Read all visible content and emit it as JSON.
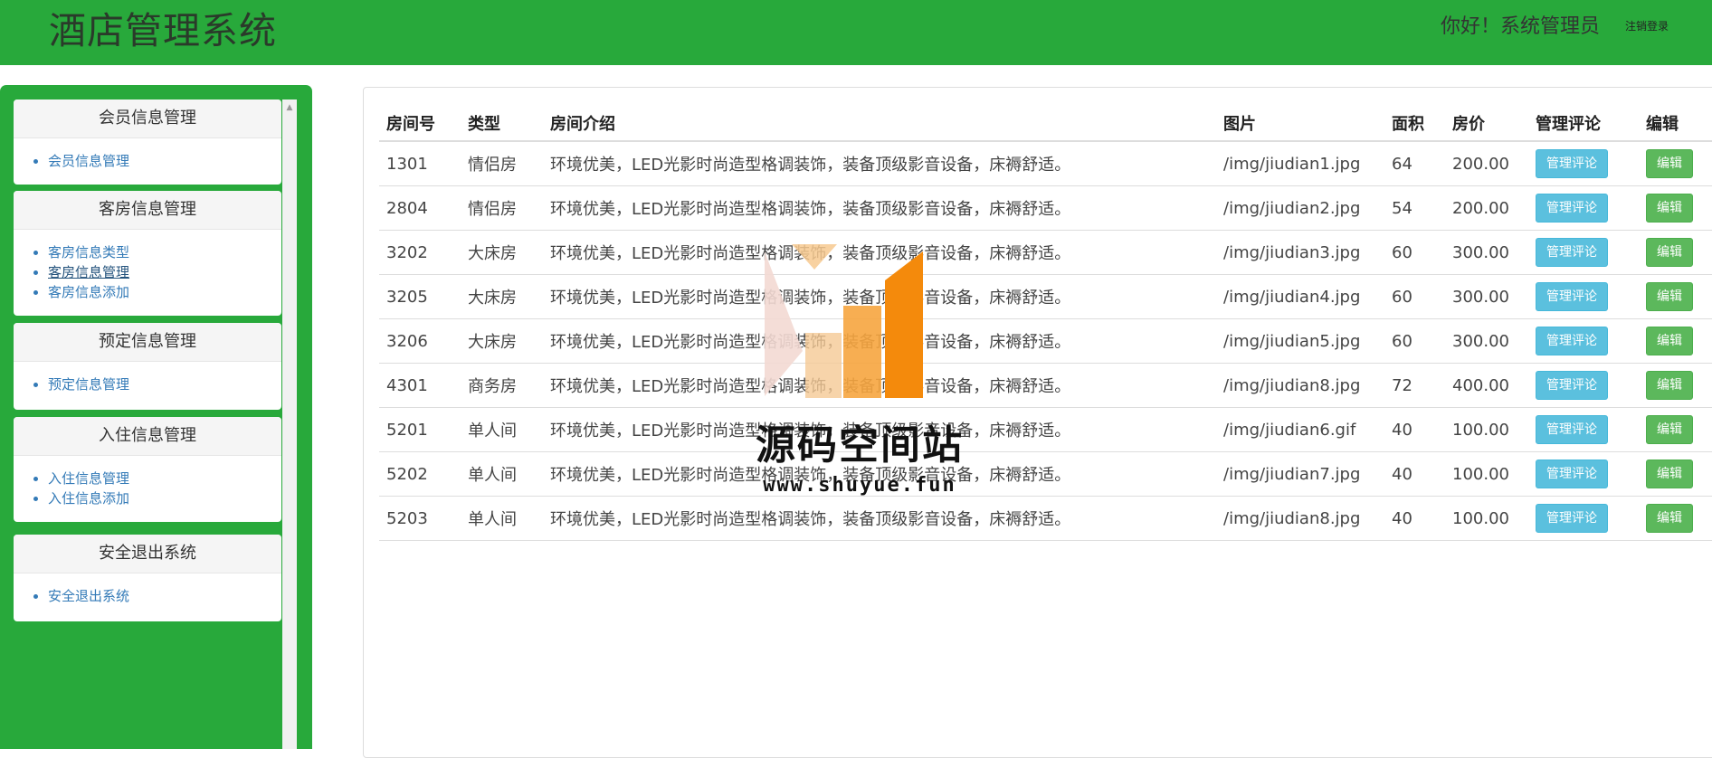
{
  "header": {
    "app_title": "酒店管理系统",
    "greeting": "你好！系统管理员",
    "logout": "注销登录"
  },
  "sidebar": {
    "panels": [
      {
        "title": "会员信息管理",
        "items": [
          "会员信息管理"
        ]
      },
      {
        "title": "客房信息管理",
        "items": [
          "客房信息类型",
          "客房信息管理",
          "客房信息添加"
        ]
      },
      {
        "title": "预定信息管理",
        "items": [
          "预定信息管理"
        ]
      },
      {
        "title": "入住信息管理",
        "items": [
          "入住信息管理",
          "入住信息添加"
        ]
      },
      {
        "title": "安全退出系统",
        "items": [
          "安全退出系统"
        ]
      }
    ]
  },
  "table": {
    "headers": [
      "房间号",
      "类型",
      "房间介绍",
      "图片",
      "面积",
      "房价",
      "管理评论",
      "编辑"
    ],
    "rows": [
      [
        "1301",
        "情侣房",
        "环境优美，LED光影时尚造型格调装饰，装备顶级影音设备，床褥舒适。",
        "/img/jiudian1.jpg",
        "64",
        "200.00"
      ],
      [
        "2804",
        "情侣房",
        "环境优美，LED光影时尚造型格调装饰，装备顶级影音设备，床褥舒适。",
        "/img/jiudian2.jpg",
        "54",
        "200.00"
      ],
      [
        "3202",
        "大床房",
        "环境优美，LED光影时尚造型格调装饰，装备顶级影音设备，床褥舒适。",
        "/img/jiudian3.jpg",
        "60",
        "300.00"
      ],
      [
        "3205",
        "大床房",
        "环境优美，LED光影时尚造型格调装饰，装备顶级影音设备，床褥舒适。",
        "/img/jiudian4.jpg",
        "60",
        "300.00"
      ],
      [
        "3206",
        "大床房",
        "环境优美，LED光影时尚造型格调装饰，装备顶级影音设备，床褥舒适。",
        "/img/jiudian5.jpg",
        "60",
        "300.00"
      ],
      [
        "4301",
        "商务房",
        "环境优美，LED光影时尚造型格调装饰，装备顶级影音设备，床褥舒适。",
        "/img/jiudian8.jpg",
        "72",
        "400.00"
      ],
      [
        "5201",
        "单人间",
        "环境优美，LED光影时尚造型格调装饰，装备顶级影音设备，床褥舒适。",
        "/img/jiudian6.gif",
        "40",
        "100.00"
      ],
      [
        "5202",
        "单人间",
        "环境优美，LED光影时尚造型格调装饰，装备顶级影音设备，床褥舒适。",
        "/img/jiudian7.jpg",
        "40",
        "100.00"
      ],
      [
        "5203",
        "单人间",
        "环境优美，LED光影时尚造型格调装饰，装备顶级影音设备，床褥舒适。",
        "/img/jiudian8.jpg",
        "40",
        "100.00"
      ]
    ],
    "review_button_label": "管理评论",
    "edit_button_label": "编辑"
  },
  "watermark": {
    "text": "源码空间站",
    "url": "www.shuyue.fun"
  },
  "colors": {
    "brand_green": "#28a93b",
    "info_button": "#5bc0de",
    "success_button": "#5cb85c",
    "link": "#337ab7"
  }
}
